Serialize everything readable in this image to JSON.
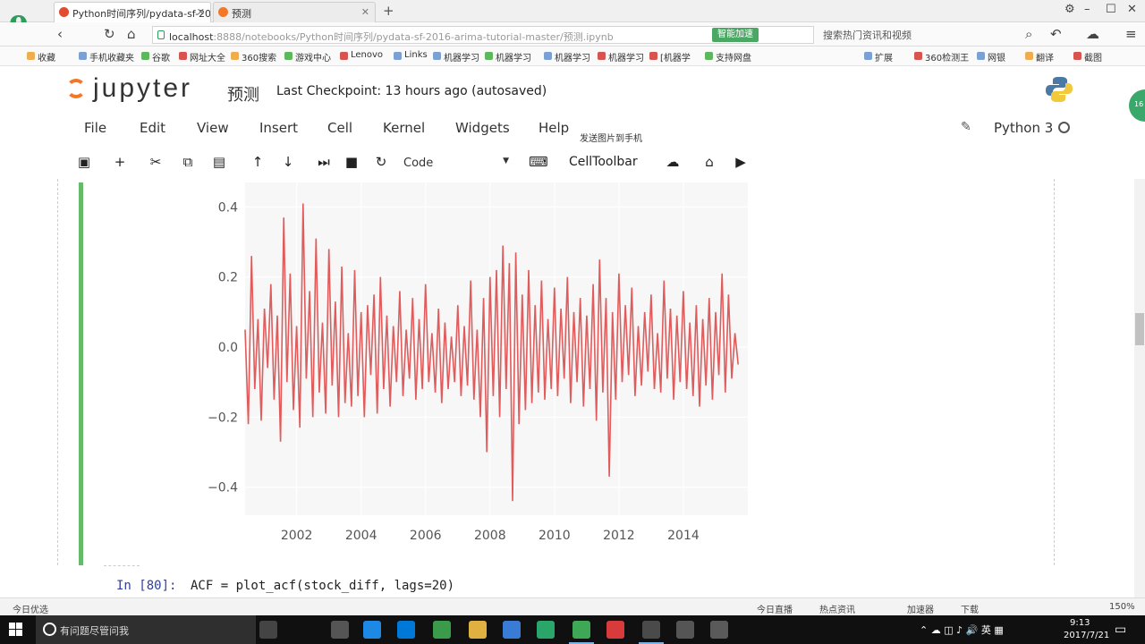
{
  "browser": {
    "tabs": [
      {
        "title": "Python时间序列/pydata-sf-201",
        "active": true
      },
      {
        "title": "预测",
        "active": false
      }
    ],
    "new_tab": "+",
    "url": {
      "host": "localhost",
      "rest": ":8888/notebooks/Python时间序列/pydata-sf-2016-arima-tutorial-master/预测.ipynb"
    },
    "speed_badge": "智能加速",
    "search_text": "搜索热门资讯和视频",
    "bookmarks": [
      "收藏",
      "手机收藏夹",
      "谷歌",
      "网址大全",
      "360搜索",
      "游戏中心",
      "Lenovo",
      "Links",
      "机器学习",
      "机器学习",
      "机器学习",
      "机器学习",
      "[机器学",
      "支持网盘",
      "扩展",
      "360检测王",
      "网银",
      "翻译",
      "截图"
    ]
  },
  "jupyter": {
    "logo": "jupyter",
    "notebook_name": "预测",
    "checkpoint": "Last Checkpoint: 13 hours ago (autosaved)",
    "menu": [
      "File",
      "Edit",
      "View",
      "Insert",
      "Cell",
      "Kernel",
      "Widgets",
      "Help"
    ],
    "share": "发送图片到手机",
    "kernel": "Python 3",
    "cell_type": "Code",
    "celltoolbar": "CellToolbar"
  },
  "chart_data": {
    "type": "line",
    "color": "#e05b5b",
    "x_ticks": [
      "2002",
      "2004",
      "2006",
      "2008",
      "2010",
      "2012",
      "2014"
    ],
    "y_ticks": [
      "0.4",
      "0.2",
      "0.0",
      "−0.2",
      "−0.4"
    ],
    "xlim": [
      2000.4,
      2016.0
    ],
    "ylim": [
      -0.48,
      0.47
    ],
    "grid": true,
    "x": [
      2000.4,
      2000.5,
      2000.6,
      2000.7,
      2000.8,
      2000.9,
      2001.0,
      2001.1,
      2001.2,
      2001.3,
      2001.4,
      2001.5,
      2001.6,
      2001.7,
      2001.8,
      2001.9,
      2002.0,
      2002.1,
      2002.2,
      2002.3,
      2002.4,
      2002.5,
      2002.6,
      2002.7,
      2002.8,
      2002.9,
      2003.0,
      2003.1,
      2003.2,
      2003.3,
      2003.4,
      2003.5,
      2003.6,
      2003.7,
      2003.8,
      2003.9,
      2004.0,
      2004.1,
      2004.2,
      2004.3,
      2004.4,
      2004.5,
      2004.6,
      2004.7,
      2004.8,
      2004.9,
      2005.0,
      2005.1,
      2005.2,
      2005.3,
      2005.4,
      2005.5,
      2005.6,
      2005.7,
      2005.8,
      2005.9,
      2006.0,
      2006.1,
      2006.2,
      2006.3,
      2006.4,
      2006.5,
      2006.6,
      2006.7,
      2006.8,
      2006.9,
      2007.0,
      2007.1,
      2007.2,
      2007.3,
      2007.4,
      2007.5,
      2007.6,
      2007.7,
      2007.8,
      2007.9,
      2008.0,
      2008.1,
      2008.2,
      2008.3,
      2008.4,
      2008.5,
      2008.6,
      2008.7,
      2008.8,
      2008.9,
      2009.0,
      2009.1,
      2009.2,
      2009.3,
      2009.4,
      2009.5,
      2009.6,
      2009.7,
      2009.8,
      2009.9,
      2010.0,
      2010.1,
      2010.2,
      2010.3,
      2010.4,
      2010.5,
      2010.6,
      2010.7,
      2010.8,
      2010.9,
      2011.0,
      2011.1,
      2011.2,
      2011.3,
      2011.4,
      2011.5,
      2011.6,
      2011.7,
      2011.8,
      2011.9,
      2012.0,
      2012.1,
      2012.2,
      2012.3,
      2012.4,
      2012.5,
      2012.6,
      2012.7,
      2012.8,
      2012.9,
      2013.0,
      2013.1,
      2013.2,
      2013.3,
      2013.4,
      2013.5,
      2013.6,
      2013.7,
      2013.8,
      2013.9,
      2014.0,
      2014.1,
      2014.2,
      2014.3,
      2014.4,
      2014.5,
      2014.6,
      2014.7,
      2014.8,
      2014.9,
      2015.0,
      2015.1,
      2015.2,
      2015.3,
      2015.4,
      2015.5,
      2015.6,
      2015.7,
      2015.8,
      2015.9
    ],
    "values": [
      0.05,
      -0.22,
      0.26,
      -0.12,
      0.08,
      -0.21,
      0.11,
      -0.06,
      0.18,
      -0.15,
      0.09,
      -0.27,
      0.37,
      -0.1,
      0.21,
      -0.18,
      0.06,
      -0.23,
      0.41,
      -0.09,
      0.16,
      -0.2,
      0.31,
      -0.13,
      0.07,
      -0.19,
      0.28,
      -0.11,
      0.13,
      -0.2,
      0.23,
      -0.16,
      0.04,
      -0.17,
      0.22,
      -0.14,
      0.1,
      -0.2,
      0.12,
      -0.08,
      0.15,
      -0.19,
      0.2,
      -0.12,
      0.09,
      -0.17,
      0.06,
      -0.1,
      0.16,
      -0.14,
      0.05,
      -0.09,
      0.14,
      -0.15,
      0.08,
      -0.12,
      0.18,
      -0.1,
      0.04,
      -0.13,
      0.11,
      -0.16,
      0.07,
      -0.12,
      0.03,
      -0.1,
      0.12,
      -0.14,
      0.06,
      -0.11,
      0.19,
      -0.15,
      0.05,
      -0.2,
      0.14,
      -0.3,
      0.2,
      -0.14,
      0.22,
      -0.2,
      0.29,
      -0.12,
      0.24,
      -0.44,
      0.27,
      -0.22,
      0.15,
      -0.18,
      0.22,
      -0.16,
      0.12,
      -0.13,
      0.19,
      -0.15,
      0.08,
      -0.12,
      0.17,
      -0.14,
      0.11,
      -0.09,
      0.2,
      -0.16,
      0.1,
      -0.1,
      0.14,
      -0.17,
      0.09,
      -0.12,
      0.18,
      -0.21,
      0.25,
      -0.13,
      0.14,
      -0.37,
      0.1,
      -0.15,
      0.21,
      -0.1,
      0.12,
      -0.08,
      0.17,
      -0.14,
      0.06,
      -0.11,
      0.1,
      -0.07,
      0.15,
      -0.12,
      0.04,
      -0.13,
      0.19,
      -0.09,
      0.11,
      -0.15,
      0.09,
      -0.1,
      0.16,
      -0.12,
      0.07,
      -0.14,
      0.12,
      -0.17,
      0.08,
      -0.11,
      0.14,
      -0.15,
      0.1,
      -0.08,
      0.21,
      -0.13,
      0.15,
      -0.09,
      0.04,
      -0.05
    ]
  },
  "cell": {
    "prompt": "In [80]:",
    "code": "ACF = plot_acf(stock_diff, lags=20)"
  },
  "statusbar": {
    "left": "今日优选",
    "items": [
      "今日直播",
      "热点资讯",
      "加速器",
      "下载",
      "150%"
    ]
  },
  "taskbar": {
    "search": "有问题尽管问我",
    "tray_lang": "英",
    "time": "9:13",
    "date": "2017/7/21"
  }
}
